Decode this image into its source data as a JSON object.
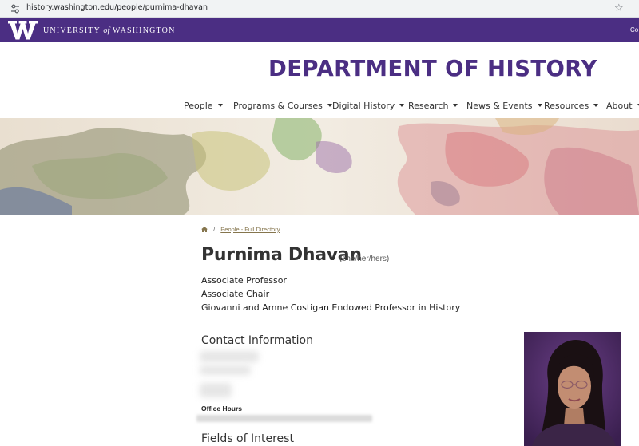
{
  "browser": {
    "url": "history.washington.edu/people/purnima-dhavan",
    "site_icon": "tune-icon",
    "bookmark_icon": "star-icon"
  },
  "uw_bar": {
    "logo": "w-logo-icon",
    "name_prefix": "UNIVERSITY",
    "name_of": "of",
    "name_suffix": "WASHINGTON",
    "right_link": "Co"
  },
  "department": {
    "title": "DEPARTMENT OF HISTORY"
  },
  "nav": {
    "items": [
      {
        "label": "People"
      },
      {
        "label": "Programs & Courses"
      },
      {
        "label": "Digital History"
      },
      {
        "label": "Research"
      },
      {
        "label": "News & Events"
      },
      {
        "label": "Resources"
      },
      {
        "label": "About"
      }
    ]
  },
  "breadcrumb": {
    "home_icon": "home-icon",
    "separator": "/",
    "link": "People - Full Directory"
  },
  "profile": {
    "name": "Purnima Dhavan",
    "pronouns": "(she/her/hers)",
    "titles": [
      "Associate Professor",
      "Associate Chair",
      "Giovanni and Amne Costigan Endowed Professor in History"
    ],
    "contact_heading": "Contact Information",
    "office_hours_label": "Office Hours",
    "fields_heading": "Fields of Interest"
  },
  "colors": {
    "uw_purple": "#4b2e83",
    "gold_link": "#85754d",
    "browser_bar": "#f1f3f4"
  }
}
